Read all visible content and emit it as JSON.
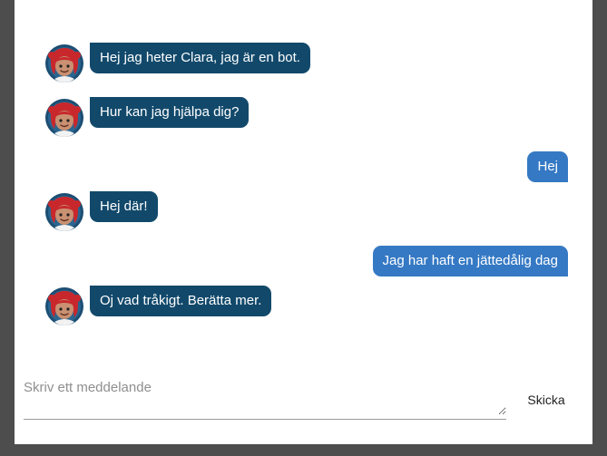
{
  "chat": {
    "messages": [
      {
        "sender": "bot",
        "text": "Hej jag heter Clara, jag är en bot."
      },
      {
        "sender": "bot",
        "text": "Hur kan jag hjälpa dig?"
      },
      {
        "sender": "user",
        "text": "Hej"
      },
      {
        "sender": "bot",
        "text": "Hej där!"
      },
      {
        "sender": "user",
        "text": "Jag har haft en jättedålig dag"
      },
      {
        "sender": "bot",
        "text": "Oj vad tråkigt. Berätta mer."
      }
    ]
  },
  "composer": {
    "placeholder": "Skriv ett meddelande",
    "value": "",
    "send_label": "Skicka"
  },
  "colors": {
    "bot_bubble": "#12496b",
    "user_bubble": "#3579c4",
    "avatar_ring": "#1c4e73",
    "hair": "#c8282c"
  },
  "icons": {
    "bot_avatar": "girl-avatar-icon"
  }
}
